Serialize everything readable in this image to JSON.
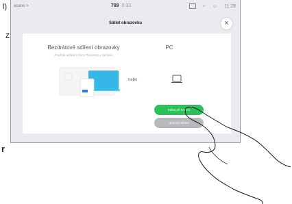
{
  "outside": {
    "top_char": "l)",
    "side_char_z": "z",
    "side_char_r": "r"
  },
  "status_bar": {
    "left_text": "acano >",
    "call_number": "789",
    "call_time": "0:33",
    "clock": "11:28"
  },
  "modal": {
    "title": "Sdílet obrazovku",
    "close_label": "×",
    "wireless": {
      "title": "Bezdrátové sdílení obrazovky",
      "subtitle": "Použijte aplikaci Cisco Proximity v zařízení"
    },
    "or_label": "nebo",
    "pc_label": "PC",
    "share_button": "Sdílet při hovoru",
    "call_button": "Ukončit náhled"
  },
  "colors": {
    "share_button": "#2bc15a",
    "call_button": "#b7b9bd",
    "device_screen": "#35b8e8"
  }
}
